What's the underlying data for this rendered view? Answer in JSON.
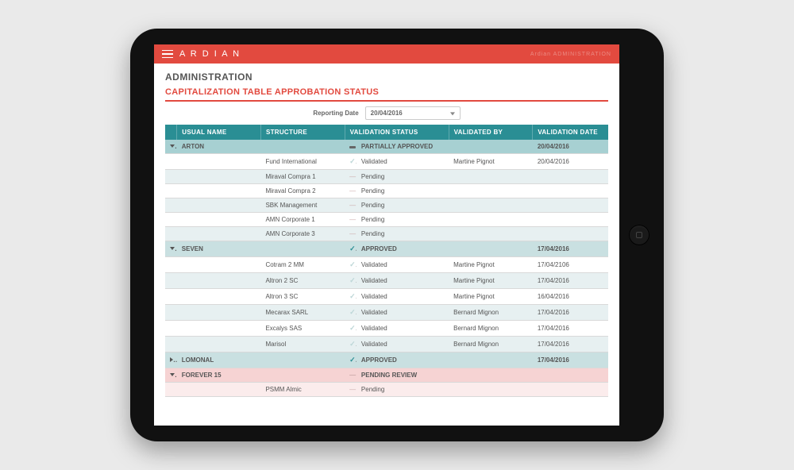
{
  "topbar": {
    "brand": "A R D I A N",
    "right_text": "Ardian ADMINISTRATION"
  },
  "page": {
    "title": "ADMINISTRATION",
    "section": "CAPITALIZATION TABLE APPROBATION STATUS",
    "filter_label": "Reporting Date",
    "filter_value": "20/04/2016"
  },
  "columns": {
    "name": "USUAL NAME",
    "structure": "STRUCTURE",
    "status": "VALIDATION STATUS",
    "by": "VALIDATED BY",
    "date": "VALIDATION DATE"
  },
  "groups": [
    {
      "id": "arton",
      "name": "ARTON",
      "expanded": true,
      "status": "PARTIALLY APPROVED",
      "status_kind": "mixed",
      "by": "",
      "date": "20/04/2016",
      "children": [
        {
          "structure": "Fund International",
          "status": "Validated",
          "status_kind": "check",
          "by": "Martine Pignot",
          "date": "20/04/2016"
        },
        {
          "structure": "Miraval Compra 1",
          "status": "Pending",
          "status_kind": "dash",
          "by": "",
          "date": ""
        },
        {
          "structure": "Miraval Compra 2",
          "status": "Pending",
          "status_kind": "dash",
          "by": "",
          "date": ""
        },
        {
          "structure": "SBK Management",
          "status": "Pending",
          "status_kind": "dash",
          "by": "",
          "date": ""
        },
        {
          "structure": "AMN Corporate 1",
          "status": "Pending",
          "status_kind": "dash",
          "by": "",
          "date": ""
        },
        {
          "structure": "AMN Corporate 3",
          "status": "Pending",
          "status_kind": "dash",
          "by": "",
          "date": ""
        }
      ]
    },
    {
      "id": "seven",
      "name": "SEVEN",
      "expanded": true,
      "status": "APPROVED",
      "status_kind": "approved",
      "by": "",
      "date": "17/04/2016",
      "children": [
        {
          "structure": "Cotram 2 MM",
          "status": "Validated",
          "status_kind": "check",
          "by": "Martine Pignot",
          "date": "17/04/2106"
        },
        {
          "structure": "Altron 2 SC",
          "status": "Validated",
          "status_kind": "check",
          "by": "Martine Pignot",
          "date": "17/04/2016"
        },
        {
          "structure": "Altron 3 SC",
          "status": "Validated",
          "status_kind": "check",
          "by": "Martine Pignot",
          "date": "16/04/2016"
        },
        {
          "structure": "Mecarax  SARL",
          "status": "Validated",
          "status_kind": "check",
          "by": "Bernard Mignon",
          "date": "17/04/2016"
        },
        {
          "structure": "Excalys SAS",
          "status": "Validated",
          "status_kind": "check",
          "by": "Bernard Mignon",
          "date": "17/04/2016"
        },
        {
          "structure": "Marisol",
          "status": "Validated",
          "status_kind": "check",
          "by": "Bernard Mignon",
          "date": "17/04/2016"
        }
      ]
    },
    {
      "id": "lomonal",
      "name": "LOMONAL",
      "expanded": false,
      "status": "APPROVED",
      "status_kind": "approved",
      "by": "",
      "date": "17/04/2016",
      "children": []
    },
    {
      "id": "forever15",
      "name": "FOREVER 15",
      "expanded": true,
      "status": "PENDING REVIEW",
      "status_kind": "review",
      "by": "",
      "date": "",
      "children": [
        {
          "structure": "PSMM Almic",
          "status": "Pending",
          "status_kind": "dash",
          "by": "",
          "date": ""
        }
      ]
    }
  ]
}
